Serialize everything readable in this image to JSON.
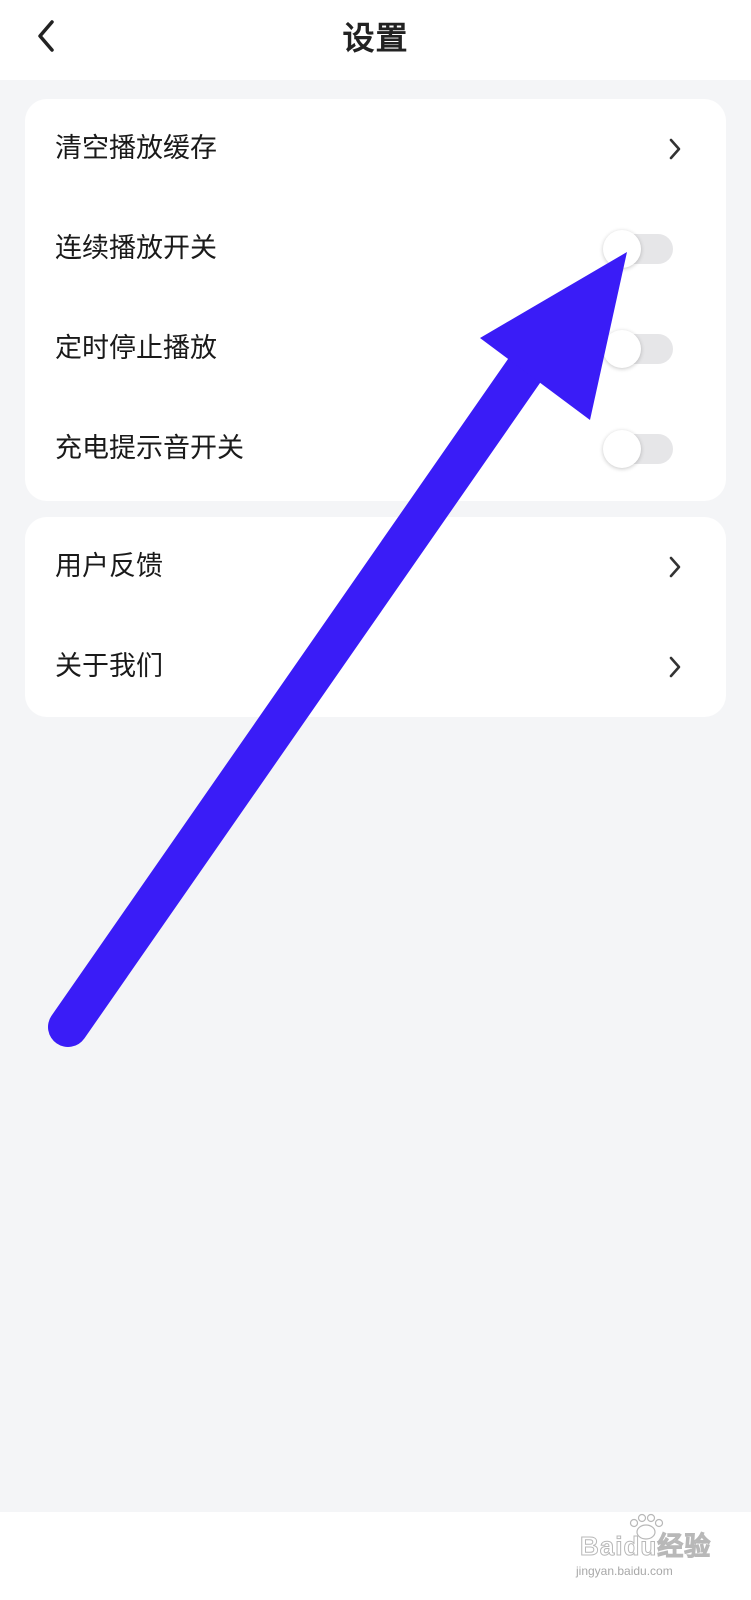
{
  "header": {
    "title": "设置",
    "back_icon": "chevron-left-icon"
  },
  "settings_group": {
    "items": [
      {
        "label": "清空播放缓存",
        "control": "chevron-right-icon"
      },
      {
        "label": "连续播放开关",
        "control": "toggle",
        "on": false
      },
      {
        "label": "定时停止播放",
        "control": "toggle",
        "on": false
      },
      {
        "label": "充电提示音开关",
        "control": "toggle",
        "on": false
      }
    ]
  },
  "info_group": {
    "items": [
      {
        "label": "用户反馈",
        "control": "chevron-right-icon"
      },
      {
        "label": "关于我们",
        "control": "chevron-right-icon"
      }
    ]
  },
  "annotation": {
    "arrow_color": "#3a1cf7",
    "description_icon": "pointer-arrow-icon"
  },
  "watermark": {
    "main": "Baidu经验",
    "sub": "jingyan.baidu.com",
    "icon": "paw-icon"
  },
  "colors": {
    "background": "#f4f5f7",
    "card": "#ffffff",
    "toggle_off": "#e6e6e8"
  }
}
